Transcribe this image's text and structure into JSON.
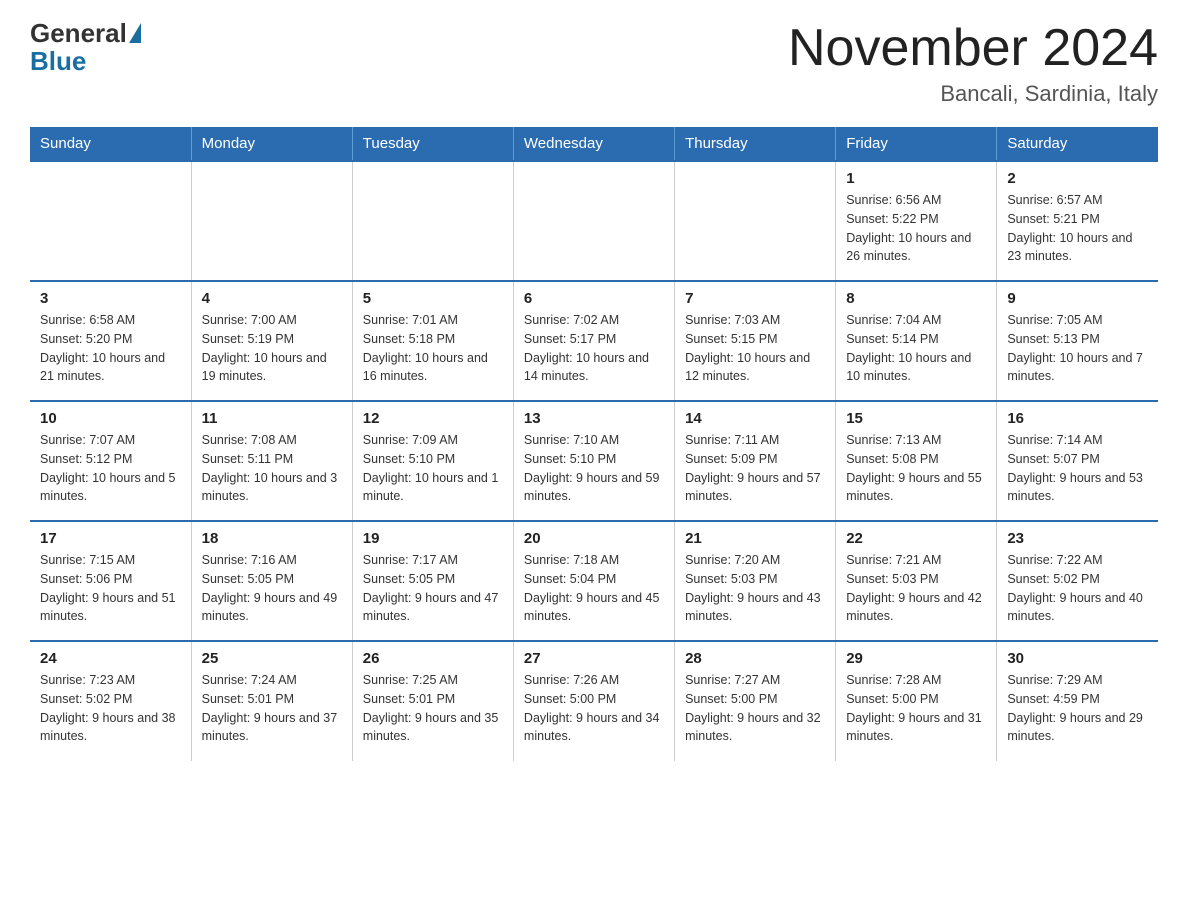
{
  "header": {
    "logo_general": "General",
    "logo_blue": "Blue",
    "month_title": "November 2024",
    "location": "Bancali, Sardinia, Italy"
  },
  "days_of_week": [
    "Sunday",
    "Monday",
    "Tuesday",
    "Wednesday",
    "Thursday",
    "Friday",
    "Saturday"
  ],
  "weeks": [
    {
      "days": [
        {
          "number": "",
          "info": ""
        },
        {
          "number": "",
          "info": ""
        },
        {
          "number": "",
          "info": ""
        },
        {
          "number": "",
          "info": ""
        },
        {
          "number": "",
          "info": ""
        },
        {
          "number": "1",
          "info": "Sunrise: 6:56 AM\nSunset: 5:22 PM\nDaylight: 10 hours and 26 minutes."
        },
        {
          "number": "2",
          "info": "Sunrise: 6:57 AM\nSunset: 5:21 PM\nDaylight: 10 hours and 23 minutes."
        }
      ]
    },
    {
      "days": [
        {
          "number": "3",
          "info": "Sunrise: 6:58 AM\nSunset: 5:20 PM\nDaylight: 10 hours and 21 minutes."
        },
        {
          "number": "4",
          "info": "Sunrise: 7:00 AM\nSunset: 5:19 PM\nDaylight: 10 hours and 19 minutes."
        },
        {
          "number": "5",
          "info": "Sunrise: 7:01 AM\nSunset: 5:18 PM\nDaylight: 10 hours and 16 minutes."
        },
        {
          "number": "6",
          "info": "Sunrise: 7:02 AM\nSunset: 5:17 PM\nDaylight: 10 hours and 14 minutes."
        },
        {
          "number": "7",
          "info": "Sunrise: 7:03 AM\nSunset: 5:15 PM\nDaylight: 10 hours and 12 minutes."
        },
        {
          "number": "8",
          "info": "Sunrise: 7:04 AM\nSunset: 5:14 PM\nDaylight: 10 hours and 10 minutes."
        },
        {
          "number": "9",
          "info": "Sunrise: 7:05 AM\nSunset: 5:13 PM\nDaylight: 10 hours and 7 minutes."
        }
      ]
    },
    {
      "days": [
        {
          "number": "10",
          "info": "Sunrise: 7:07 AM\nSunset: 5:12 PM\nDaylight: 10 hours and 5 minutes."
        },
        {
          "number": "11",
          "info": "Sunrise: 7:08 AM\nSunset: 5:11 PM\nDaylight: 10 hours and 3 minutes."
        },
        {
          "number": "12",
          "info": "Sunrise: 7:09 AM\nSunset: 5:10 PM\nDaylight: 10 hours and 1 minute."
        },
        {
          "number": "13",
          "info": "Sunrise: 7:10 AM\nSunset: 5:10 PM\nDaylight: 9 hours and 59 minutes."
        },
        {
          "number": "14",
          "info": "Sunrise: 7:11 AM\nSunset: 5:09 PM\nDaylight: 9 hours and 57 minutes."
        },
        {
          "number": "15",
          "info": "Sunrise: 7:13 AM\nSunset: 5:08 PM\nDaylight: 9 hours and 55 minutes."
        },
        {
          "number": "16",
          "info": "Sunrise: 7:14 AM\nSunset: 5:07 PM\nDaylight: 9 hours and 53 minutes."
        }
      ]
    },
    {
      "days": [
        {
          "number": "17",
          "info": "Sunrise: 7:15 AM\nSunset: 5:06 PM\nDaylight: 9 hours and 51 minutes."
        },
        {
          "number": "18",
          "info": "Sunrise: 7:16 AM\nSunset: 5:05 PM\nDaylight: 9 hours and 49 minutes."
        },
        {
          "number": "19",
          "info": "Sunrise: 7:17 AM\nSunset: 5:05 PM\nDaylight: 9 hours and 47 minutes."
        },
        {
          "number": "20",
          "info": "Sunrise: 7:18 AM\nSunset: 5:04 PM\nDaylight: 9 hours and 45 minutes."
        },
        {
          "number": "21",
          "info": "Sunrise: 7:20 AM\nSunset: 5:03 PM\nDaylight: 9 hours and 43 minutes."
        },
        {
          "number": "22",
          "info": "Sunrise: 7:21 AM\nSunset: 5:03 PM\nDaylight: 9 hours and 42 minutes."
        },
        {
          "number": "23",
          "info": "Sunrise: 7:22 AM\nSunset: 5:02 PM\nDaylight: 9 hours and 40 minutes."
        }
      ]
    },
    {
      "days": [
        {
          "number": "24",
          "info": "Sunrise: 7:23 AM\nSunset: 5:02 PM\nDaylight: 9 hours and 38 minutes."
        },
        {
          "number": "25",
          "info": "Sunrise: 7:24 AM\nSunset: 5:01 PM\nDaylight: 9 hours and 37 minutes."
        },
        {
          "number": "26",
          "info": "Sunrise: 7:25 AM\nSunset: 5:01 PM\nDaylight: 9 hours and 35 minutes."
        },
        {
          "number": "27",
          "info": "Sunrise: 7:26 AM\nSunset: 5:00 PM\nDaylight: 9 hours and 34 minutes."
        },
        {
          "number": "28",
          "info": "Sunrise: 7:27 AM\nSunset: 5:00 PM\nDaylight: 9 hours and 32 minutes."
        },
        {
          "number": "29",
          "info": "Sunrise: 7:28 AM\nSunset: 5:00 PM\nDaylight: 9 hours and 31 minutes."
        },
        {
          "number": "30",
          "info": "Sunrise: 7:29 AM\nSunset: 4:59 PM\nDaylight: 9 hours and 29 minutes."
        }
      ]
    }
  ]
}
